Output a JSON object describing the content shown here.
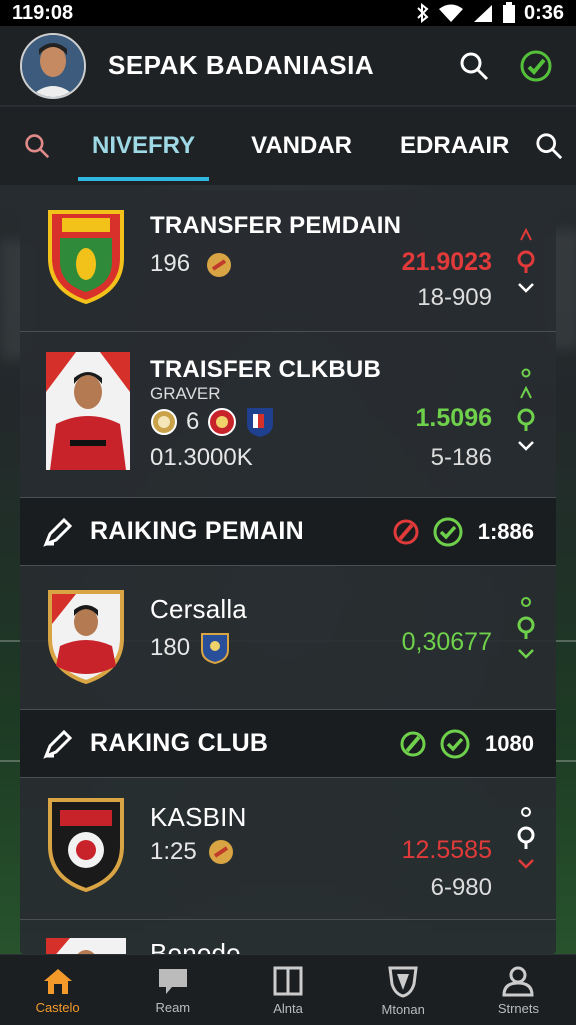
{
  "status_bar": {
    "time": "119:08",
    "clock_right": "0:36",
    "icons": [
      "bluetooth-icon",
      "wifi-icon",
      "signal-icon",
      "battery-icon"
    ]
  },
  "header": {
    "title": "SEPAK BADANIASIA",
    "search_icon": "search-icon",
    "action_icon": "check-badge-icon"
  },
  "tabs": [
    {
      "label": "NIVEFRY",
      "active": true
    },
    {
      "label": "VANDAR",
      "active": false
    },
    {
      "label": "EDRAAIR",
      "active": false
    }
  ],
  "rows": {
    "transfer_pemain": {
      "title": "TRANSFER PEMDAIN",
      "number": "196",
      "value_main": "21.9023",
      "value_sub": "18-909"
    },
    "transfer_club": {
      "title": "TRAISFER CLKBUB",
      "subtitle": "GRAVER",
      "number": "6",
      "amount": "01.3000K",
      "value_main": "1.5096",
      "value_sub": "5-186"
    },
    "ranking_pemain": {
      "title": "RAIKING PEMAIN",
      "value": "1:886"
    },
    "player_row": {
      "title": "Cersalla",
      "number": "180",
      "value_main": "0,30677"
    },
    "ranking_club": {
      "title": "RAKING CLUB",
      "value": "1080"
    },
    "club_row": {
      "title": "KASBIN",
      "number": "1:25",
      "value_main": "12.5585",
      "value_sub": "6-980"
    },
    "partial_row": {
      "title": "Bonodo"
    }
  },
  "bottom_nav": [
    {
      "label": "Castelo",
      "icon": "home-icon",
      "active": true
    },
    {
      "label": "Ream",
      "icon": "chat-icon",
      "active": false
    },
    {
      "label": "Alnta",
      "icon": "book-icon",
      "active": false
    },
    {
      "label": "Mtonan",
      "icon": "shield-icon",
      "active": false
    },
    {
      "label": "Strnets",
      "icon": "user-icon",
      "active": false
    }
  ],
  "colors": {
    "accent": "#2fb8e0",
    "red": "#e03a3a",
    "green": "#6fd04b",
    "nav_active": "#f39a2b"
  }
}
